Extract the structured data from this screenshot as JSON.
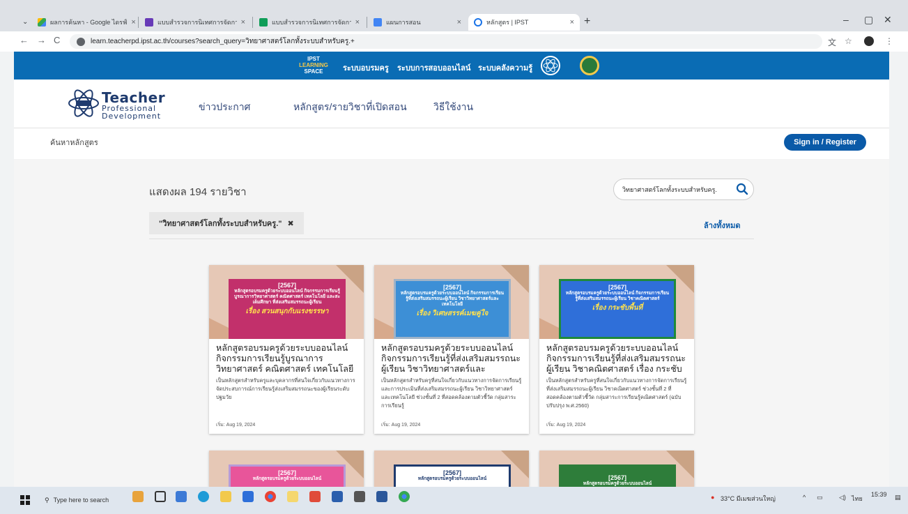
{
  "browser": {
    "tabs": [
      {
        "label": "ผลการค้นหา - Google ไดรฟ์",
        "icon": "google-drive-icon"
      },
      {
        "label": "แบบสำรวจการนิเทศการจัดการเรียนรู้ของครู",
        "icon": "forms-icon"
      },
      {
        "label": "แบบสำรวจการนิเทศการจัดการเรียนรู้ของครู",
        "icon": "sheets-icon"
      },
      {
        "label": "แผนการสอน",
        "icon": "docs-icon"
      },
      {
        "label": "หลักสูตร | IPST",
        "icon": "ipst-icon"
      }
    ],
    "url": "learn.teacherpd.ipst.ac.th/courses?search_query=วิทยาศาสตร์โลกทั้งระบบสำหรับครู.+"
  },
  "topbar": {
    "logo_l1": "IPST",
    "logo_l2": "LEARNING",
    "logo_l3": "SPACE",
    "links": [
      "ระบบอบรมครู",
      "ระบบการสอบออนไลน์",
      "ระบบคลังความรู้"
    ]
  },
  "header": {
    "brand_title": "Teacher",
    "brand_sub1": "Professional",
    "brand_sub2": "Development",
    "nav": [
      "ข่าวประกาศ",
      "หลักสูตร/รายวิชาที่เปิดสอน",
      "วิธีใช้งาน"
    ]
  },
  "subbar": {
    "label": "ค้นหาหลักสูตร",
    "signin": "Sign in / Register"
  },
  "results": {
    "count_text": "แสดงผล 194 รายวิชา",
    "search_value": "วิทยาศาสตร์โลกทั้งระบบสำหรับครู.",
    "filter_chip": "\"วิทยาศาสตร์โลกทั้งระบบสำหรับครู.\"",
    "clear_all": "ล้างทั้งหมด"
  },
  "cards": [
    {
      "thumb_year": "[2567]",
      "thumb_text": "หลักสูตรอบรมครูด้วยระบบออนไลน์ กิจกรรมการเรียนรู้บูรณาการวิทยาศาสตร์ คณิตศาสตร์ เทคโนโลยี และสะเต็มศึกษา ที่ส่งเสริมสมรรถนะผู้เรียน",
      "thumb_topic": "เรื่อง สวนสนุกกับแรงขรรษา",
      "title": "หลักสูตรอบรมครูด้วยระบบออนไลน์ กิจกรรมการเรียนรู้บูรณาการ วิทยาศาสตร์ คณิตศาสตร์ เทคโนโลยี",
      "desc": "เป็นหลักสูตรสำหรับครูและบุคลากรที่สนใจเกี่ยวกับแนวทางการจัดประสบการณ์การเรียนรู้ส่งเสริมสมรรถนะของผู้เรียนระดับปฐมวัย",
      "date": "เริ่ม: Aug 19, 2024",
      "panel_color": "#c2306b"
    },
    {
      "thumb_year": "[2567]",
      "thumb_text": "หลักสูตรอบรมครูด้วยระบบออนไลน์ กิจกรรมการเรียนรู้ที่ส่งเสริมสมรรถนะผู้เรียน วิชาวิทยาศาสตร์และเทคโนโลยี",
      "thumb_topic": "เรื่อง วิเศษสรรค์เมฆคู่ใจ",
      "title": "หลักสูตรอบรมครูด้วยระบบออนไลน์ กิจกรรมการเรียนรู้ที่ส่งเสริมสมรรถนะผู้เรียน วิชาวิทยาศาสตร์และ เทคโนโลยี",
      "desc": "เป็นหลักสูตรสำหรับครูที่สนใจเกี่ยวกับแนวทางการจัดการเรียนรู้และการประเมินที่ส่งเสริมสมรรถนะผู้เรียน วิชาวิทยาศาสตร์และเทคโนโลยี ช่วงชั้นที่ 2 ที่สอดคล้องตามตัวชี้วัด กลุ่มสาระการเรียนรู้",
      "date": "เริ่ม: Aug 19, 2024",
      "panel_color": "#3d8fd6"
    },
    {
      "thumb_year": "[2567]",
      "thumb_text": "หลักสูตรอบรมครูด้วยระบบออนไลน์ กิจกรรมการเรียนรู้ที่ส่งเสริมสมรรถนะผู้เรียน วิชาคณิตศาสตร์",
      "thumb_topic": "เรื่อง กระชับพื้นที่",
      "title": "หลักสูตรอบรมครูด้วยระบบออนไลน์ กิจกรรมการเรียนรู้ที่ส่งเสริมสมรรถนะผู้เรียน วิชาคณิตศาสตร์ เรื่อง กระชับพื้นที่",
      "desc": "เป็นหลักสูตรสำหรับครูที่สนใจเกี่ยวกับแนวทางการจัดการเรียนรู้ที่ส่งเสริมสมรรถนะผู้เรียน วิชาคณิตศาสตร์ ช่วงชั้นที่ 2 ที่สอดคล้องตามตัวชี้วัด กลุ่มสาระการเรียนรู้คณิตศาสตร์ (ฉบับปรับปรุง พ.ศ.2560)",
      "date": "เริ่ม: Aug 19, 2024",
      "panel_color": "#2f6fd9"
    }
  ],
  "cards_row2": [
    {
      "thumb_year": "[2567]",
      "thumb_text": "หลักสูตรอบรมครูด้วยระบบออนไลน์",
      "panel_color": "#e8559a"
    },
    {
      "thumb_year": "[2567]",
      "thumb_text": "หลักสูตรอบรมครูด้วยระบบออนไลน์",
      "panel_color": "#ffffff"
    },
    {
      "thumb_year": "[2567]",
      "thumb_text": "หลักสูตรอบรมครูด้วยระบบออนไลน์",
      "panel_color": "#2e7d3a"
    }
  ],
  "taskbar": {
    "search_placeholder": "Type here to search",
    "weather": "33°C มีเมฆส่วนใหญ่",
    "lang": "ไทย",
    "time": "15:39"
  }
}
